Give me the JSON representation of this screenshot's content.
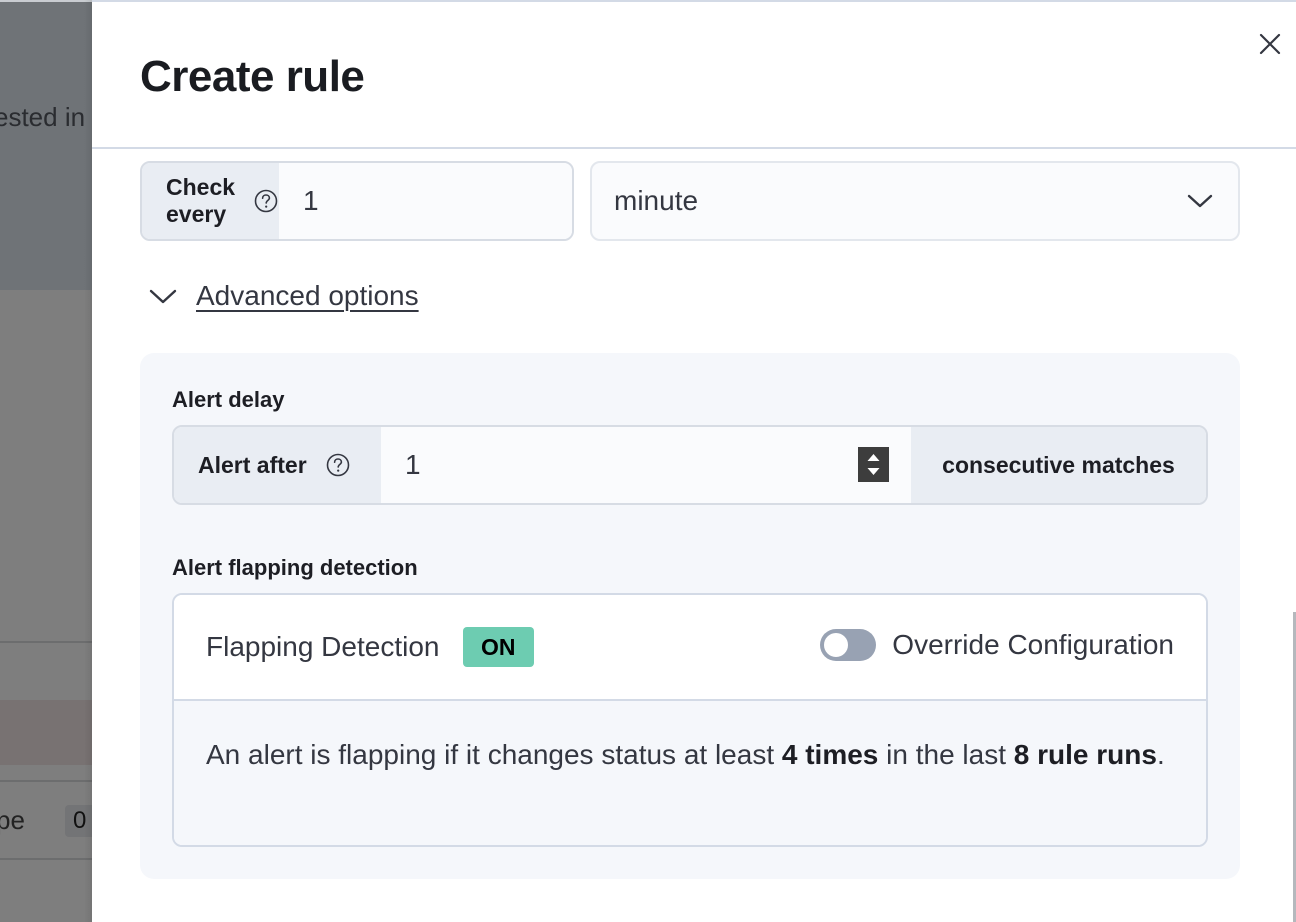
{
  "background": {
    "partial_text_1": "ested in",
    "partial_text_2": "pe",
    "partial_badge": "0"
  },
  "flyout": {
    "title": "Create rule",
    "close_icon": "close-icon"
  },
  "schedule": {
    "check_every_label": "Check every",
    "help_icon": "question-circle-icon",
    "interval_value": "1",
    "unit_value": "minute",
    "unit_icon": "chevron-down-icon"
  },
  "advanced": {
    "toggle_label": "Advanced options",
    "toggle_icon": "chevron-down-icon",
    "expanded": true,
    "alert_delay": {
      "section_label": "Alert delay",
      "prepend_label": "Alert after",
      "value": "1",
      "append_label": "consecutive matches"
    },
    "flapping": {
      "section_label": "Alert flapping detection",
      "title": "Flapping Detection",
      "status_badge": "ON",
      "status_color": "#6dccb1",
      "override_label": "Override Configuration",
      "override_enabled": false,
      "description_parts": {
        "prefix": "An alert is flapping if it changes status at least ",
        "times": "4 times",
        "middle": " in the last ",
        "runs": "8 rule runs",
        "suffix": "."
      }
    }
  }
}
